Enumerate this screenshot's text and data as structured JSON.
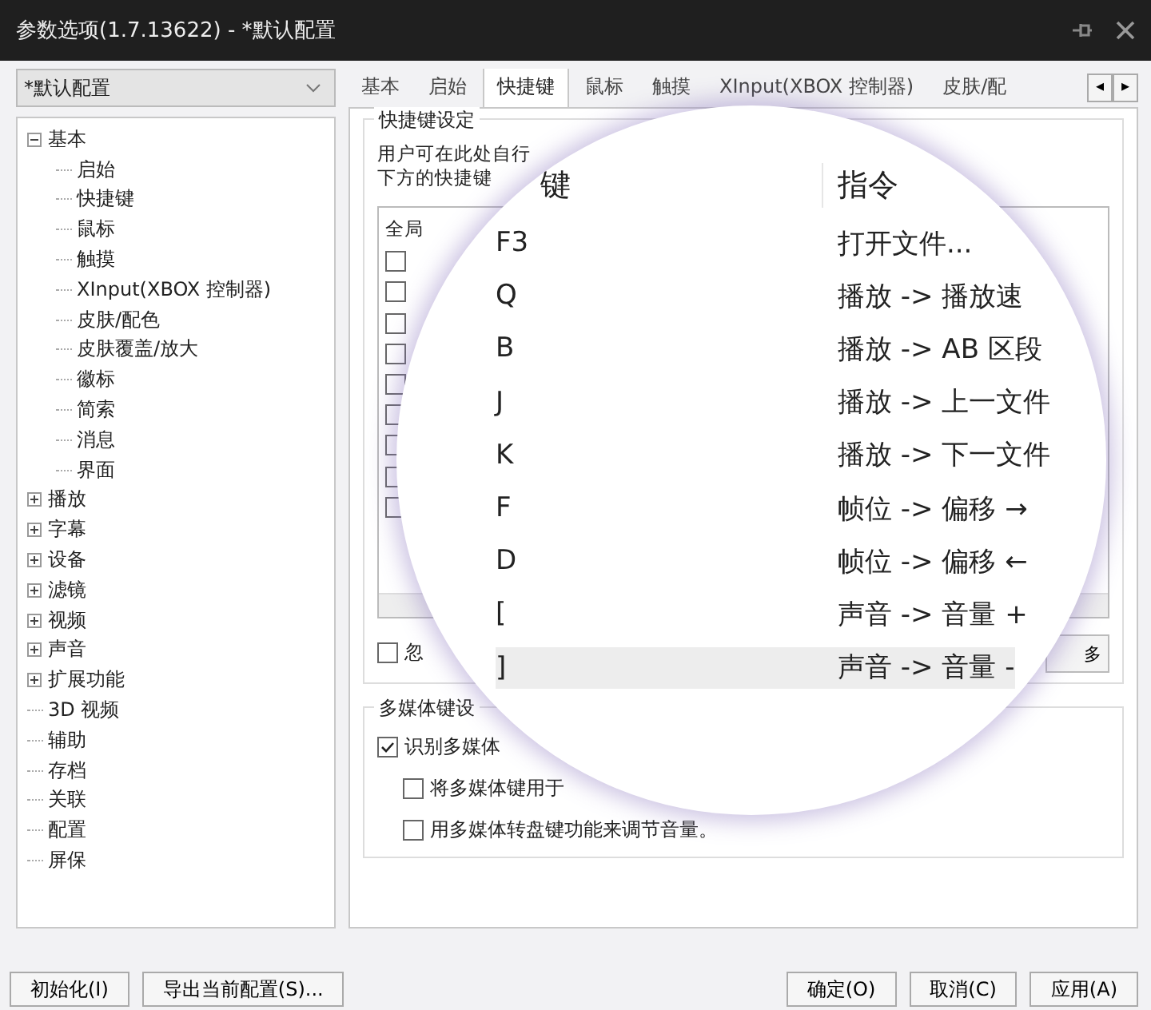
{
  "window": {
    "title": "参数选项(1.7.13622) - *默认配置"
  },
  "profile_dropdown": {
    "value": "*默认配置"
  },
  "tree": [
    {
      "label": "基本",
      "kind": "group",
      "expanded": true,
      "children": [
        {
          "label": "启始"
        },
        {
          "label": "快捷键"
        },
        {
          "label": "鼠标"
        },
        {
          "label": "触摸"
        },
        {
          "label": "XInput(XBOX 控制器)"
        },
        {
          "label": "皮肤/配色"
        },
        {
          "label": "皮肤覆盖/放大"
        },
        {
          "label": "徽标"
        },
        {
          "label": "简索"
        },
        {
          "label": "消息"
        },
        {
          "label": "界面"
        }
      ]
    },
    {
      "label": "播放",
      "kind": "group",
      "expanded": false
    },
    {
      "label": "字幕",
      "kind": "group",
      "expanded": false
    },
    {
      "label": "设备",
      "kind": "group",
      "expanded": false
    },
    {
      "label": "滤镜",
      "kind": "group",
      "expanded": false
    },
    {
      "label": "视频",
      "kind": "group",
      "expanded": false
    },
    {
      "label": "声音",
      "kind": "group",
      "expanded": false
    },
    {
      "label": "扩展功能",
      "kind": "group",
      "expanded": false
    },
    {
      "label": "3D 视频",
      "kind": "leaf"
    },
    {
      "label": "辅助",
      "kind": "leaf"
    },
    {
      "label": "存档",
      "kind": "leaf"
    },
    {
      "label": "关联",
      "kind": "leaf"
    },
    {
      "label": "配置",
      "kind": "leaf"
    },
    {
      "label": "屏保",
      "kind": "leaf"
    }
  ],
  "tabs": [
    {
      "label": "基本",
      "selected": false
    },
    {
      "label": "启始",
      "selected": false
    },
    {
      "label": "快捷键",
      "selected": true
    },
    {
      "label": "鼠标",
      "selected": false
    },
    {
      "label": "触摸",
      "selected": false
    },
    {
      "label": "XInput(XBOX 控制器)",
      "selected": false
    },
    {
      "label": "皮肤/配",
      "selected": false
    }
  ],
  "tab_scroll": {
    "left": "◂",
    "right": "▸"
  },
  "hotkey_group": {
    "title": "快捷键设定",
    "description": [
      "用户可在此处自行",
      "下方的快捷键"
    ],
    "list_header": "全局",
    "global_checks": [
      {
        "checked": false
      },
      {
        "checked": false
      },
      {
        "checked": false
      },
      {
        "checked": false
      },
      {
        "checked": false
      },
      {
        "checked": false
      },
      {
        "checked": false
      },
      {
        "checked": false
      },
      {
        "checked": false
      }
    ],
    "ignore_check": {
      "label": "忽",
      "checked": false
    },
    "side_button": "多"
  },
  "media_group": {
    "title": "多媒体键设",
    "options": [
      {
        "label": "识别多媒体",
        "checked": true,
        "sub": false
      },
      {
        "label": "将多媒体键用于",
        "checked": false,
        "sub": true
      },
      {
        "label": "用多媒体转盘键功能来调节音量。",
        "checked": false,
        "sub": true
      }
    ]
  },
  "magnifier": {
    "columns": [
      "键",
      "指令"
    ],
    "rows": [
      {
        "key": "F3",
        "command": "打开文件...",
        "selected": false
      },
      {
        "key": "Q",
        "command": "播放 -> 播放速",
        "selected": false
      },
      {
        "key": "B",
        "command": "播放 -> AB 区段",
        "selected": false
      },
      {
        "key": "J",
        "command": "播放 -> 上一文件",
        "selected": false
      },
      {
        "key": "K",
        "command": "播放 -> 下一文件",
        "selected": false
      },
      {
        "key": "F",
        "command": "帧位 -> 偏移 →",
        "selected": false
      },
      {
        "key": "D",
        "command": "帧位 -> 偏移 ←",
        "selected": false
      },
      {
        "key": "[",
        "command": "声音 -> 音量 +",
        "selected": false
      },
      {
        "key": "]",
        "command": "声音 -> 音量 -",
        "selected": true
      }
    ]
  },
  "left_buttons": [
    "初始化(I)",
    "导出当前配置(S)..."
  ],
  "right_buttons": [
    "确定(O)",
    "取消(C)",
    "应用(A)"
  ]
}
